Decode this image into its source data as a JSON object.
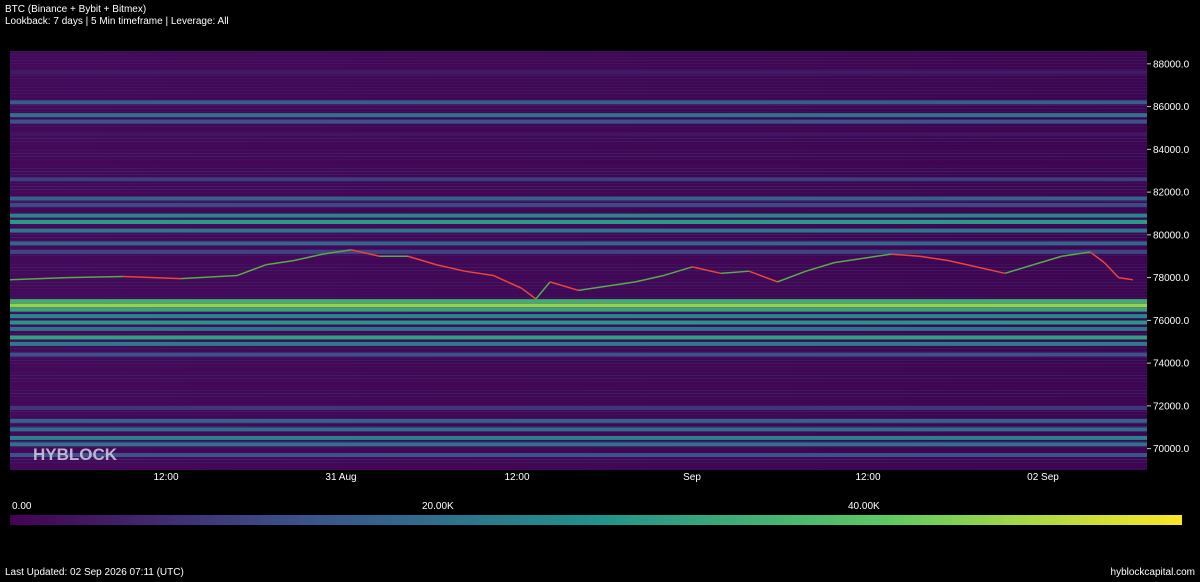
{
  "header": {
    "title": "BTC (Binance + Bybit + Bitmex)",
    "subtitle": "Lookback: 7 days | 5 Min timeframe | Leverage: All"
  },
  "watermark": "HYBLOCK",
  "colorbar": {
    "labels": [
      "0.00",
      "20.00K",
      "40.00K"
    ],
    "colors": [
      "#440154",
      "#3b528b",
      "#21918c",
      "#5ec962",
      "#fde725"
    ]
  },
  "footer": {
    "updated": "Last Updated: 02 Sep 2026 07:11 (UTC)",
    "site": "hyblockcapital.com"
  },
  "colors": {
    "background": "#000000",
    "price_line": "#e8453c",
    "price_line_up": "#5aa84f"
  },
  "chart_data": {
    "type": "heatmap",
    "title": "BTC (Binance + Bybit + Bitmex)",
    "y_ticks": [
      88000,
      86000,
      84000,
      82000,
      80000,
      78000,
      76000,
      74000,
      72000,
      70000
    ],
    "y_tick_labels": [
      "88000.0",
      "86000.0",
      "84000.0",
      "82000.0",
      "80000.0",
      "78000.0",
      "76000.0",
      "74000.0",
      "72000.0",
      "70000.0"
    ],
    "ylim": [
      69000,
      88600
    ],
    "x_ticks": [
      "12:00",
      "31 Aug",
      "12:00",
      "Sep",
      "12:00",
      "02 Sep"
    ],
    "xlim": [
      "2026-08-30 00:00",
      "2026-09-02 08:00"
    ],
    "colorbar_range": [
      0,
      48000
    ],
    "liquidity_bands": [
      {
        "price": 87600,
        "value": 4000
      },
      {
        "price": 86200,
        "value": 14000
      },
      {
        "price": 85600,
        "value": 18000
      },
      {
        "price": 85300,
        "value": 12000
      },
      {
        "price": 84700,
        "value": 3000
      },
      {
        "price": 82600,
        "value": 9000
      },
      {
        "price": 81700,
        "value": 15000
      },
      {
        "price": 81400,
        "value": 11000
      },
      {
        "price": 80900,
        "value": 22000
      },
      {
        "price": 80600,
        "value": 26000
      },
      {
        "price": 80200,
        "value": 19000
      },
      {
        "price": 79600,
        "value": 16000
      },
      {
        "price": 79200,
        "value": 10000
      },
      {
        "price": 76900,
        "value": 30000
      },
      {
        "price": 76700,
        "value": 40000
      },
      {
        "price": 76500,
        "value": 28000
      },
      {
        "price": 76200,
        "value": 22000
      },
      {
        "price": 75900,
        "value": 25000
      },
      {
        "price": 75600,
        "value": 18000
      },
      {
        "price": 75200,
        "value": 27000
      },
      {
        "price": 74900,
        "value": 20000
      },
      {
        "price": 74400,
        "value": 12000
      },
      {
        "price": 71900,
        "value": 8000
      },
      {
        "price": 71300,
        "value": 15000
      },
      {
        "price": 70900,
        "value": 17000
      },
      {
        "price": 70500,
        "value": 21000
      },
      {
        "price": 70200,
        "value": 18000
      },
      {
        "price": 69700,
        "value": 12000
      }
    ],
    "price_series": [
      {
        "t": "2026-08-30 00:00",
        "price": 77900
      },
      {
        "t": "2026-08-30 04:00",
        "price": 78000
      },
      {
        "t": "2026-08-30 08:00",
        "price": 78050
      },
      {
        "t": "2026-08-30 12:00",
        "price": 77950
      },
      {
        "t": "2026-08-30 16:00",
        "price": 78100
      },
      {
        "t": "2026-08-30 18:00",
        "price": 78600
      },
      {
        "t": "2026-08-30 20:00",
        "price": 78800
      },
      {
        "t": "2026-08-30 22:00",
        "price": 79100
      },
      {
        "t": "2026-08-31 00:00",
        "price": 79300
      },
      {
        "t": "2026-08-31 02:00",
        "price": 79000
      },
      {
        "t": "2026-08-31 04:00",
        "price": 79000
      },
      {
        "t": "2026-08-31 06:00",
        "price": 78600
      },
      {
        "t": "2026-08-31 08:00",
        "price": 78300
      },
      {
        "t": "2026-08-31 10:00",
        "price": 78100
      },
      {
        "t": "2026-08-31 12:00",
        "price": 77500
      },
      {
        "t": "2026-08-31 13:00",
        "price": 77000
      },
      {
        "t": "2026-08-31 14:00",
        "price": 77800
      },
      {
        "t": "2026-08-31 16:00",
        "price": 77400
      },
      {
        "t": "2026-08-31 18:00",
        "price": 77600
      },
      {
        "t": "2026-08-31 20:00",
        "price": 77800
      },
      {
        "t": "2026-08-31 22:00",
        "price": 78100
      },
      {
        "t": "2026-09-01 00:00",
        "price": 78500
      },
      {
        "t": "2026-09-01 02:00",
        "price": 78200
      },
      {
        "t": "2026-09-01 04:00",
        "price": 78300
      },
      {
        "t": "2026-09-01 06:00",
        "price": 77800
      },
      {
        "t": "2026-09-01 08:00",
        "price": 78300
      },
      {
        "t": "2026-09-01 10:00",
        "price": 78700
      },
      {
        "t": "2026-09-01 12:00",
        "price": 78900
      },
      {
        "t": "2026-09-01 14:00",
        "price": 79100
      },
      {
        "t": "2026-09-01 16:00",
        "price": 79000
      },
      {
        "t": "2026-09-01 18:00",
        "price": 78800
      },
      {
        "t": "2026-09-01 20:00",
        "price": 78500
      },
      {
        "t": "2026-09-01 22:00",
        "price": 78200
      },
      {
        "t": "2026-09-02 00:00",
        "price": 78600
      },
      {
        "t": "2026-09-02 02:00",
        "price": 79000
      },
      {
        "t": "2026-09-02 04:00",
        "price": 79200
      },
      {
        "t": "2026-09-02 05:00",
        "price": 78700
      },
      {
        "t": "2026-09-02 06:00",
        "price": 78000
      },
      {
        "t": "2026-09-02 07:00",
        "price": 77900
      }
    ]
  }
}
